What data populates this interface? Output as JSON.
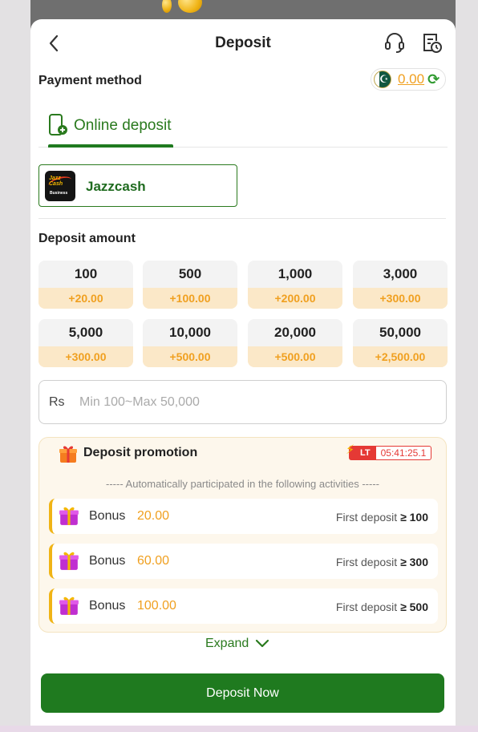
{
  "header": {
    "title": "Deposit"
  },
  "payment": {
    "label": "Payment method",
    "balance": "0.00"
  },
  "tabs": [
    {
      "label": "Online deposit"
    }
  ],
  "channels": [
    {
      "name": "Jazzcash",
      "logo_text_top": "Jazz Cash",
      "logo_text_bottom": "Business"
    }
  ],
  "amounts": {
    "label": "Deposit amount",
    "options": [
      {
        "value": "100",
        "bonus": "+20.00"
      },
      {
        "value": "500",
        "bonus": "+100.00"
      },
      {
        "value": "1,000",
        "bonus": "+200.00"
      },
      {
        "value": "3,000",
        "bonus": "+300.00"
      },
      {
        "value": "5,000",
        "bonus": "+300.00"
      },
      {
        "value": "10,000",
        "bonus": "+500.00"
      },
      {
        "value": "20,000",
        "bonus": "+500.00"
      },
      {
        "value": "50,000",
        "bonus": "+2,500.00"
      }
    ]
  },
  "input": {
    "currency": "Rs",
    "placeholder": "Min 100~Max 50,000"
  },
  "promotion": {
    "title": "Deposit promotion",
    "badge": "LT",
    "countdown": "05:41:25.1",
    "note": "----- Automatically participated in the following activities -----",
    "items": [
      {
        "label": "Bonus",
        "amount": "20.00",
        "condition_prefix": "First deposit",
        "condition_op": "≥",
        "condition_value": "100"
      },
      {
        "label": "Bonus",
        "amount": "60.00",
        "condition_prefix": "First deposit",
        "condition_op": "≥",
        "condition_value": "300"
      },
      {
        "label": "Bonus",
        "amount": "100.00",
        "condition_prefix": "First deposit",
        "condition_op": "≥",
        "condition_value": "500"
      }
    ]
  },
  "expand_label": "Expand",
  "cta_label": "Deposit Now",
  "colors": {
    "primary": "#1f7a1f",
    "accent": "#f0a020",
    "timer": "#e53935"
  },
  "icons": {
    "back": "chevron-left-icon",
    "support": "headset-icon",
    "history": "clipboard-clock-icon",
    "refresh": "refresh-icon",
    "tab": "phone-deposit-icon",
    "gift": "gift-icon",
    "expand": "chevron-down-icon"
  }
}
